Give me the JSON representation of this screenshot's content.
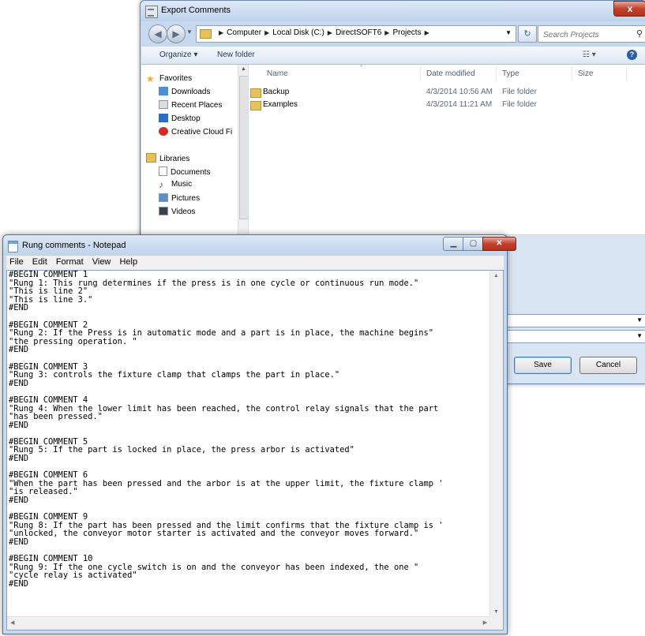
{
  "export_dialog": {
    "title": "Export Comments",
    "close_glyph": "x",
    "breadcrumbs": [
      "Computer",
      "Local Disk (C:)",
      "DirectSOFT6",
      "Projects"
    ],
    "search_placeholder": "Search Projects",
    "toolbar": {
      "organize": "Organize ▾",
      "new_folder": "New folder"
    },
    "nav": {
      "favorites": "Favorites",
      "favorites_items": [
        "Downloads",
        "Recent Places",
        "Desktop",
        "Creative Cloud Fi"
      ],
      "libraries": "Libraries",
      "libraries_items": [
        "Documents",
        "Music",
        "Pictures",
        "Videos"
      ]
    },
    "columns": [
      "Name",
      "Date modified",
      "Type",
      "Size"
    ],
    "files": [
      {
        "name": "Backup",
        "date": "4/3/2014 10:56 AM",
        "type": "File folder"
      },
      {
        "name": "Examples",
        "date": "4/3/2014 11:21 AM",
        "type": "File folder"
      }
    ],
    "save_label": "Save",
    "cancel_label": "Cancel"
  },
  "notepad": {
    "title": "Rung comments - Notepad",
    "menu": [
      "File",
      "Edit",
      "Format",
      "View",
      "Help"
    ],
    "content": "#BEGIN COMMENT 1\n\"Rung 1: This rung determines if the press is in one cycle or continuous run mode.\"\n\"This is line 2\"\n\"This is line 3.\"\n#END\n\n#BEGIN COMMENT 2\n\"Rung 2: If the Press is in automatic mode and a part is in place, the machine begins\"\n\"the pressing operation. \"\n#END\n\n#BEGIN COMMENT 3\n\"Rung 3: controls the fixture clamp that clamps the part in place.\"\n#END\n\n#BEGIN COMMENT 4\n\"Rung 4: When the lower limit has been reached, the control relay signals that the part\n\"has been pressed.\"\n#END\n\n#BEGIN COMMENT 5\n\"Rung 5: If the part is locked in place, the press arbor is activated\"\n#END\n\n#BEGIN COMMENT 6\n\"When the part has been pressed and the arbor is at the upper limit, the fixture clamp '\n\"is released.\"\n#END\n\n#BEGIN COMMENT 9\n\"Rung 8: If the part has been pressed and the limit confirms that the fixture clamp is '\n\"unlocked, the conveyor motor starter is activated and the conveyor moves forward.\"\n#END\n\n#BEGIN COMMENT 10\n\"Rung 9: If the one cycle switch is on and the conveyor has been indexed, the one \"\n\"cycle relay is activated\"\n#END"
  }
}
